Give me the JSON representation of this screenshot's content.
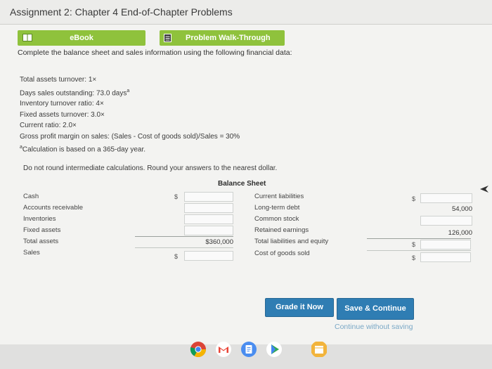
{
  "header": {
    "title": "Assignment 2: Chapter 4 End-of-Chapter Problems"
  },
  "tabs": {
    "ebook": "eBook",
    "walkthrough": "Problem Walk-Through"
  },
  "instructions": "Complete the balance sheet and sales information using the following financial data:",
  "facts": {
    "total_assets_turnover": "Total assets turnover: 1×",
    "days_sales_outstanding": "Days sales outstanding: 73.0 days",
    "dso_marker": "a",
    "inventory_turnover": "Inventory turnover ratio: 4×",
    "fixed_assets_turnover": "Fixed assets turnover: 3.0×",
    "current_ratio": "Current ratio: 2.0×",
    "gross_profit_margin": "Gross profit margin on sales: (Sales - Cost of goods sold)/Sales = 30%",
    "footnote_marker": "a",
    "footnote": "Calculation is based on a 365-day year."
  },
  "note": "Do not round intermediate calculations. Round your answers to the nearest dollar.",
  "balance_sheet": {
    "title": "Balance Sheet",
    "left_labels": {
      "cash": "Cash",
      "accounts_receivable": "Accounts receivable",
      "inventories": "Inventories",
      "fixed_assets": "Fixed assets",
      "total_assets": "Total assets",
      "sales": "Sales"
    },
    "right_labels": {
      "current_liabilities": "Current liabilities",
      "long_term_debt": "Long-term debt",
      "common_stock": "Common stock",
      "retained_earnings": "Retained earnings",
      "total_liabilities_equity": "Total liabilities and equity",
      "cogs": "Cost of goods sold"
    },
    "currency_symbol": "$",
    "values": {
      "total_assets": "$360,000",
      "long_term_debt": "54,000",
      "retained_earnings": "126,000"
    }
  },
  "buttons": {
    "grade": "Grade it Now",
    "save": "Save & Continue",
    "continue_without_saving": "Continue without saving"
  }
}
